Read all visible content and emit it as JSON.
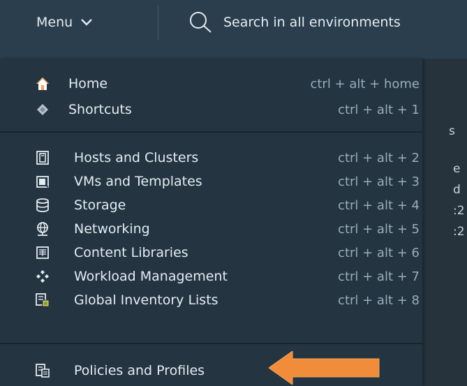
{
  "header": {
    "menu_label": "Menu",
    "search_placeholder": "Search in all environments"
  },
  "background_fragments": [
    "s",
    "e",
    "d",
    ":2",
    ":2"
  ],
  "menu": {
    "group1": [
      {
        "label": "Home",
        "shortcut": "ctrl + alt + home",
        "icon": "home-icon"
      },
      {
        "label": "Shortcuts",
        "shortcut": "ctrl + alt + 1",
        "icon": "shortcuts-icon"
      }
    ],
    "group2": [
      {
        "label": "Hosts and Clusters",
        "shortcut": "ctrl + alt + 2",
        "icon": "hosts-clusters-icon"
      },
      {
        "label": "VMs and Templates",
        "shortcut": "ctrl + alt + 3",
        "icon": "vm-icon"
      },
      {
        "label": "Storage",
        "shortcut": "ctrl + alt + 4",
        "icon": "storage-icon"
      },
      {
        "label": "Networking",
        "shortcut": "ctrl + alt + 5",
        "icon": "network-icon"
      },
      {
        "label": "Content Libraries",
        "shortcut": "ctrl + alt + 6",
        "icon": "library-icon"
      },
      {
        "label": "Workload Management",
        "shortcut": "ctrl + alt + 7",
        "icon": "workload-icon"
      },
      {
        "label": "Global Inventory Lists",
        "shortcut": "ctrl + alt + 8",
        "icon": "inventory-icon"
      }
    ],
    "group3": [
      {
        "label": "Policies and Profiles",
        "icon": "policies-icon"
      }
    ]
  },
  "colors": {
    "header_bg": "#2b3e4d",
    "menu_bg": "#243541",
    "text": "#e4ecf2",
    "shortcut_text": "#9aabba",
    "arrow": "#f08c3a",
    "home_icon": "#f4a261"
  }
}
